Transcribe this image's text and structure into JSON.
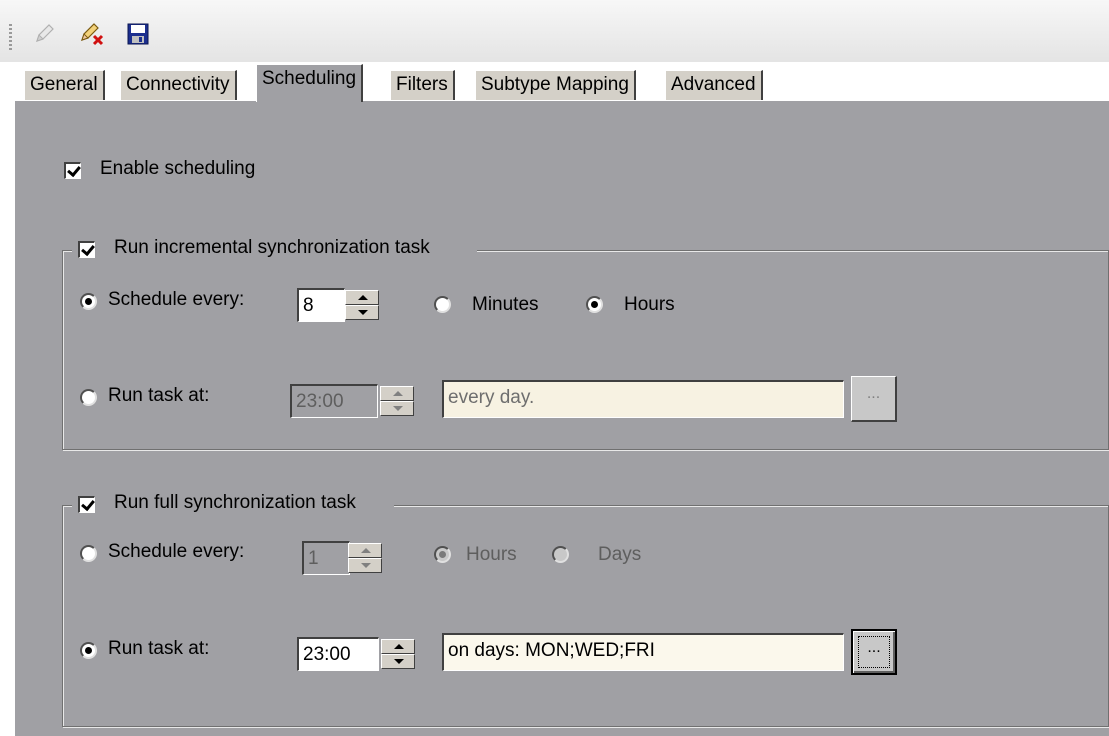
{
  "toolbar": {
    "icons": [
      "pencil-icon",
      "pencil-delete-icon",
      "save-disk-icon"
    ]
  },
  "tabs": [
    {
      "label": "General"
    },
    {
      "label": "Connectivity"
    },
    {
      "label": "Scheduling",
      "active": true
    },
    {
      "label": "Filters"
    },
    {
      "label": "Subtype Mapping"
    },
    {
      "label": "Advanced"
    }
  ],
  "scheduling": {
    "enable_label": "Enable scheduling",
    "enable_checked": true,
    "incremental": {
      "title": "Run incremental synchronization task",
      "checked": true,
      "schedule_every_label": "Schedule every:",
      "schedule_every_value": "8",
      "unit_minutes_label": "Minutes",
      "unit_hours_label": "Hours",
      "selected_unit": "Hours",
      "run_task_at_label": "Run task at:",
      "run_task_at_time": "23:00",
      "run_task_at_days": "every day.",
      "browse_label": "...",
      "selected_mode": "schedule_every"
    },
    "full": {
      "title": "Run full synchronization task",
      "checked": true,
      "schedule_every_label": "Schedule every:",
      "schedule_every_value": "1",
      "unit_hours_label": "Hours",
      "unit_days_label": "Days",
      "selected_unit": "Hours",
      "run_task_at_label": "Run task at:",
      "run_task_at_time": "23:00",
      "run_task_at_days": "on days: MON;WED;FRI",
      "browse_label": "...",
      "selected_mode": "run_task_at"
    }
  },
  "colors": {
    "panel_bg": "#a0a0a4",
    "tab_bg": "#d4d0c8",
    "field_cream": "#fbf8ec"
  }
}
